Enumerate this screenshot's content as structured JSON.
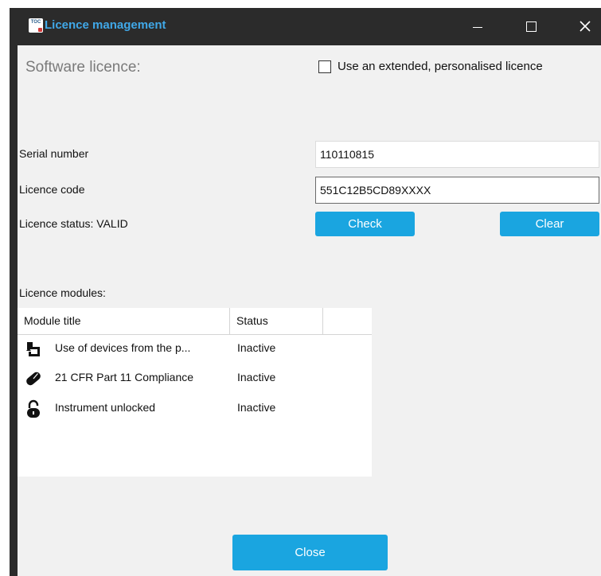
{
  "window": {
    "title": "Licence management",
    "app_icon_text": "TOC"
  },
  "licence": {
    "heading": "Software licence:",
    "extended_checkbox_label": "Use an extended, personalised licence",
    "extended_checked": false,
    "serial_label": "Serial number",
    "serial_value": "110110815",
    "code_label": "Licence code",
    "code_value": "551C12B5CD89XXXX",
    "status_label": "Licence status: VALID",
    "check_button": "Check",
    "clear_button": "Clear"
  },
  "modules": {
    "heading": "Licence modules:",
    "columns": [
      "Module title",
      "Status",
      ""
    ],
    "rows": [
      {
        "icon": "device-plug-icon",
        "title": "Use of devices from the p...",
        "status": "Inactive"
      },
      {
        "icon": "pill-capsule-icon",
        "title": "21 CFR Part 11 Compliance",
        "status": "Inactive"
      },
      {
        "icon": "unlocked-padlock-icon",
        "title": "Instrument unlocked",
        "status": "Inactive"
      }
    ]
  },
  "footer": {
    "close_button": "Close"
  },
  "colors": {
    "accent": "#1aa5e0",
    "title_text": "#40a8e8",
    "titlebar": "#2b2b2b",
    "background": "#f1f1f1"
  }
}
